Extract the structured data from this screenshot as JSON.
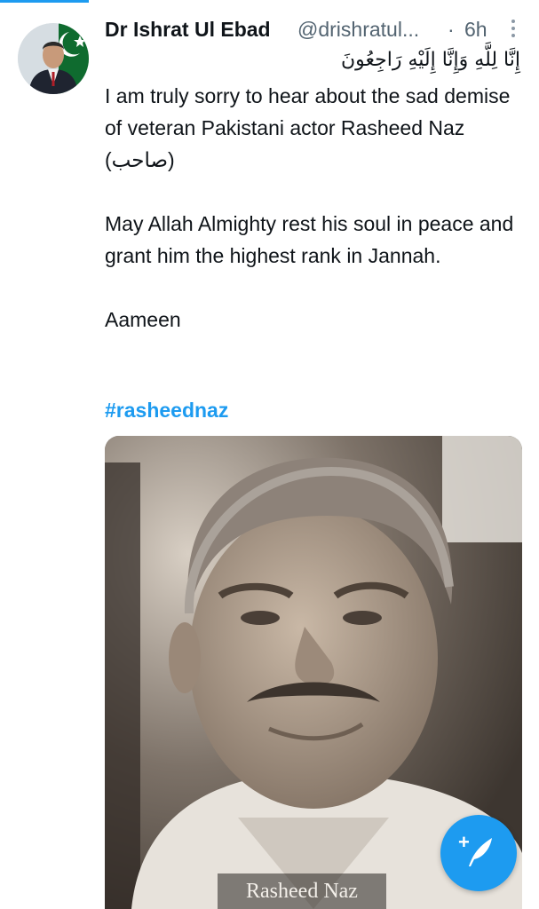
{
  "tweet": {
    "author_name": "Dr Ishrat Ul Ebad",
    "handle": "@drishratul...",
    "separator": "·",
    "time": "6h",
    "arabic_line": "إِنَّا لِلَّهِ وَإِنَّا إِلَيْهِ رَاجِعُونَ",
    "paragraphs": [
      "I am truly sorry to hear about the sad demise of veteran Pakistani actor Rasheed Naz (صاحب)",
      "May Allah Almighty rest his soul in peace and grant him the highest rank in Jannah.",
      "Aameen"
    ],
    "hashtag": "#rasheednaz",
    "media_caption": "Rasheed Naz"
  },
  "icons": {
    "more": "more-vertical-icon",
    "compose": "compose-tweet-icon"
  },
  "colors": {
    "accent": "#1d9bf0",
    "text": "#0f1419",
    "secondary": "#536471"
  }
}
